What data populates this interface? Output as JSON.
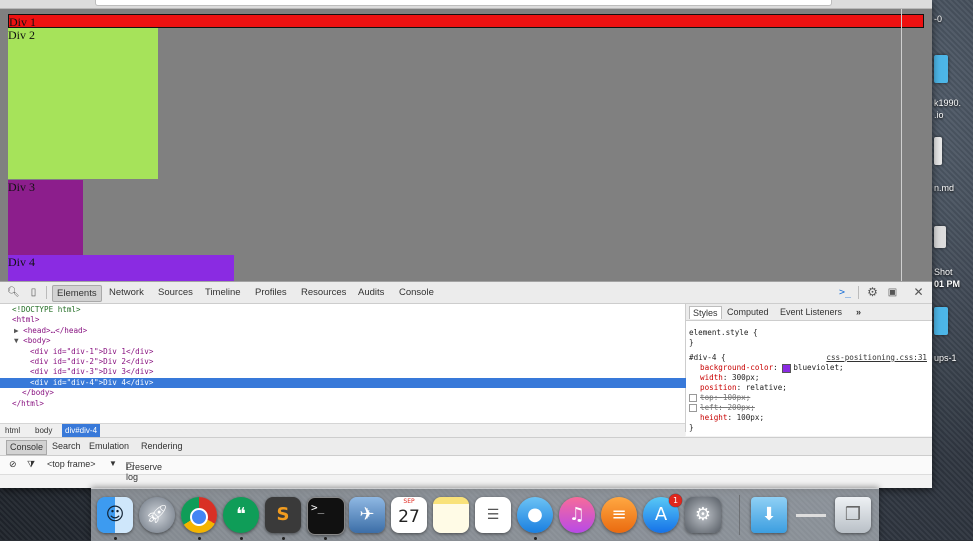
{
  "page": {
    "div1": "Div 1",
    "div2": "Div 2",
    "div3": "Div 3",
    "div4": "Div 4",
    "colors": {
      "div1": "#ee1111",
      "div2": "#a6e35a",
      "div3": "#8c1e8c",
      "div4": "#8a2be2",
      "body": "#808080"
    }
  },
  "devtools": {
    "tabs": [
      "Elements",
      "Network",
      "Sources",
      "Timeline",
      "Profiles",
      "Resources",
      "Audits",
      "Console"
    ],
    "active_tab": "Elements",
    "dom_tree": [
      "<!DOCTYPE html>",
      "<html>",
      "<head>…</head>",
      "<body>",
      "<div id=\"div-1\">Div 1</div>",
      "<div id=\"div-2\">Div 2</div>",
      "<div id=\"div-3\">Div 3</div>",
      "<div id=\"div-4\">Div 4</div>",
      "</body>",
      "</html>"
    ],
    "selected_node": "<div id=\"div-4\">Div 4</div>",
    "breadcrumbs": [
      "html",
      "body",
      "div#div-4"
    ],
    "styles": {
      "tabs": [
        "Styles",
        "Computed",
        "Event Listeners",
        "»"
      ],
      "element_style": "element.style {",
      "close_brace": "}",
      "rule_selector": "#div-4 {",
      "rule_source": "css-positioning.css:31",
      "props": [
        {
          "name": "background-color",
          "value": "blueviolet;",
          "swatch": "#8a2be2"
        },
        {
          "name": "width",
          "value": "300px;"
        },
        {
          "name": "position",
          "value": "relative;"
        },
        {
          "name": "top",
          "value": "100px;",
          "disabled": true
        },
        {
          "name": "left",
          "value": "200px;",
          "disabled": true
        },
        {
          "name": "height",
          "value": "100px;"
        }
      ]
    },
    "console_bar": {
      "tabs": [
        "Console",
        "Search",
        "Emulation",
        "Rendering"
      ],
      "frame": "<top frame>",
      "preserve_log": "Preserve log"
    }
  },
  "desktop": {
    "labels": [
      "-0",
      "k1990.",
      ".io",
      "n.md",
      "Shot",
      "01 PM",
      "ups-1"
    ]
  },
  "dock": {
    "apps": [
      "Finder",
      "Launchpad",
      "Chrome",
      "Hangouts",
      "Sublime Text",
      "Terminal",
      "Preview",
      "Calendar",
      "Notes",
      "Reminders",
      "Messages",
      "iTunes",
      "iBooks",
      "App Store",
      "System Preferences",
      "Downloads",
      "Chrome Stack",
      "Trash"
    ],
    "calendar_month": "SEP",
    "calendar_day": "27",
    "appstore_badge": "1"
  }
}
